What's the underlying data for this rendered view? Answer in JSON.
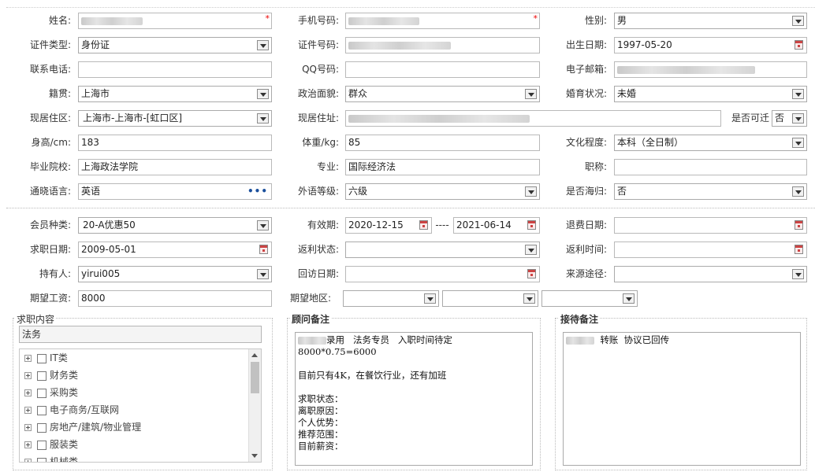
{
  "basic": {
    "name_label": "姓名:",
    "phone_label": "手机号码:",
    "gender_label": "性别:",
    "gender_value": "男",
    "idtype_label": "证件类型:",
    "idtype_value": "身份证",
    "idno_label": "证件号码:",
    "birth_label": "出生日期:",
    "birth_value": "1997-05-20",
    "contact_label": "联系电话:",
    "qq_label": "QQ号码:",
    "email_label": "电子邮箱:",
    "native_label": "籍贯:",
    "native_value": "上海市",
    "political_label": "政治面貌:",
    "political_value": "群众",
    "marital_label": "婚育状况:",
    "marital_value": "未婚",
    "region_label": "现居住区:",
    "region_value": "上海市-上海市-[虹口区]",
    "address_label": "现居住址:",
    "relocate_label": "是否可迁",
    "relocate_value": "否",
    "height_label": "身高/cm:",
    "height_value": "183",
    "weight_label": "体重/kg:",
    "weight_value": "85",
    "education_label": "文化程度:",
    "education_value": "本科（全日制）",
    "school_label": "毕业院校:",
    "school_value": "上海政法学院",
    "major_label": "专业:",
    "major_value": "国际经济法",
    "title_label": "职称:",
    "language_label": "通晓语言:",
    "language_value": "英语",
    "language_more": "•••",
    "foreign_level_label": "外语等级:",
    "foreign_level_value": "六级",
    "overseas_label": "是否海归:",
    "overseas_value": "否"
  },
  "member": {
    "type_label": "会员种类:",
    "type_value": "20-A优惠50",
    "valid_label": "有效期:",
    "valid_from": "2020-12-15",
    "valid_sep": "----",
    "valid_to": "2021-06-14",
    "refund_date_label": "退费日期:",
    "apply_date_label": "求职日期:",
    "apply_date_value": "2009-05-01",
    "rebate_status_label": "返利状态:",
    "rebate_time_label": "返利时间:",
    "holder_label": "持有人:",
    "holder_value": "yirui005",
    "visit_date_label": "回访日期:",
    "source_label": "来源途径:",
    "salary_label": "期望工资:",
    "salary_value": "8000",
    "area_label": "期望地区:"
  },
  "job": {
    "title": "求职内容",
    "search_value": "法务",
    "categories": [
      "IT类",
      "财务类",
      "采购类",
      "电子商务/互联网",
      "房地产/建筑/物业管理",
      "服装类",
      "机械类"
    ]
  },
  "consultant": {
    "title": "顾问备注",
    "line1": "录用   法务专员   入职时间待定",
    "rest": "8000*0.75=6000\n\n目前只有4K，在餐饮行业，还有加班\n\n求职状态：\n离职原因：\n个人优势：\n推荐范围：\n目前薪资："
  },
  "reception": {
    "title": "接待备注",
    "line1": "转账  协议已回传"
  }
}
